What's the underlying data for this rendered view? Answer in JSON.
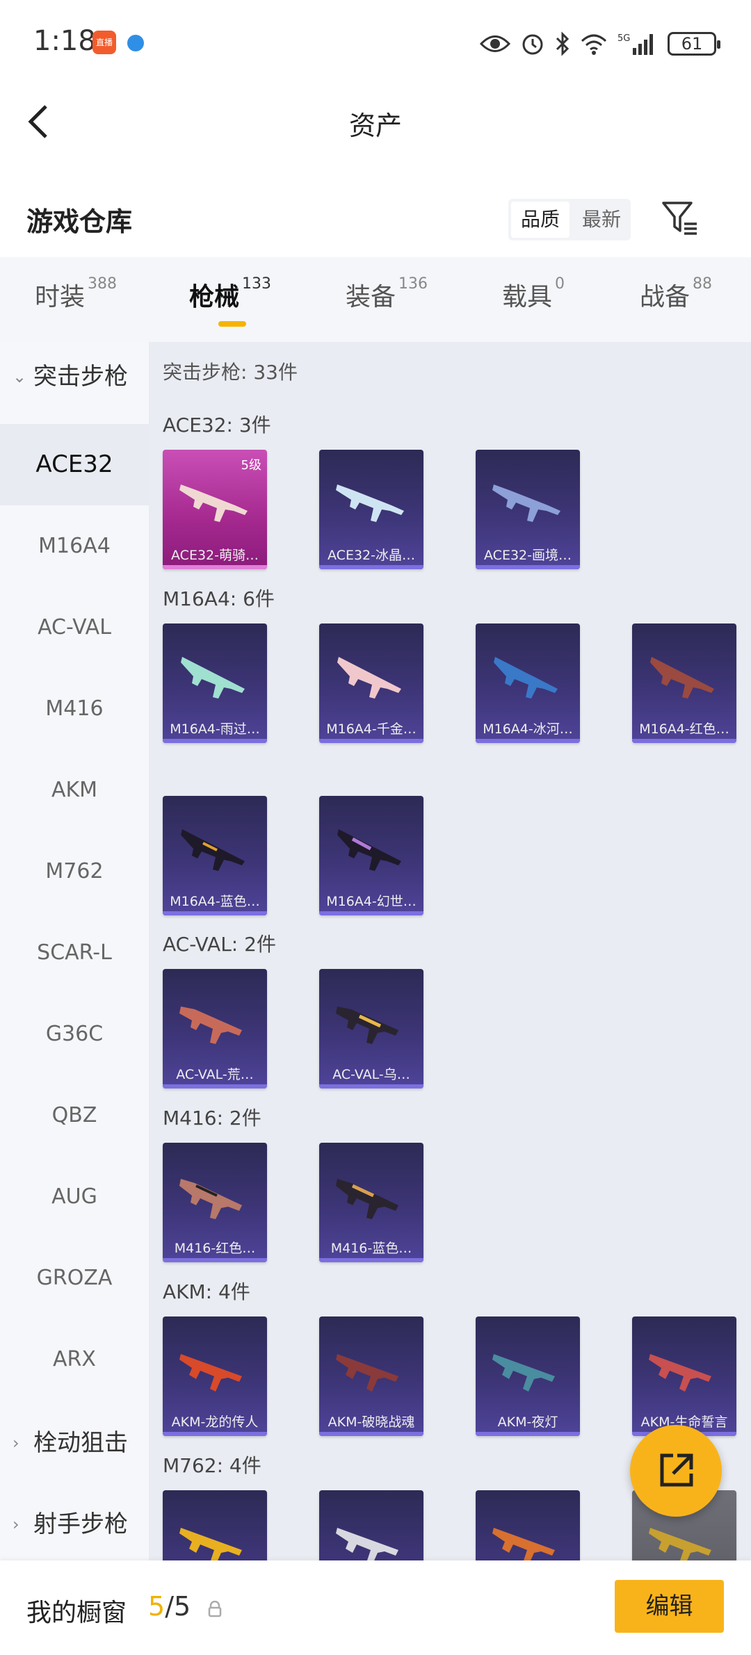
{
  "status_bar": {
    "time": "1:18",
    "app_badge": "直播",
    "battery": "61"
  },
  "header": {
    "title": "资产"
  },
  "section": {
    "title": "游戏仓库",
    "sort_options": [
      "品质",
      "最新"
    ]
  },
  "tabs": [
    {
      "label": "时装",
      "count": "388"
    },
    {
      "label": "枪械",
      "count": "133"
    },
    {
      "label": "装备",
      "count": "136"
    },
    {
      "label": "载具",
      "count": "0"
    },
    {
      "label": "战备",
      "count": "88"
    }
  ],
  "sidebar": {
    "group_assault": "突击步枪",
    "items": [
      "ACE32",
      "M16A4",
      "AC-VAL",
      "M416",
      "AKM",
      "M762",
      "SCAR-L",
      "G36C",
      "QBZ",
      "AUG",
      "GROZA",
      "ARX"
    ],
    "group_bolt": "栓动狙击",
    "group_marksman": "射手步枪"
  },
  "content": {
    "total": "突击步枪: 33件",
    "groups": [
      {
        "title": "ACE32: 3件",
        "cards": [
          "ACE32-萌骑…",
          "ACE32-冰晶…",
          "ACE32-画境…"
        ],
        "level": "5级"
      },
      {
        "title": "M16A4: 6件",
        "cards": [
          "M16A4-雨过…",
          "M16A4-千金…",
          "M16A4-冰河…",
          "M16A4-红色…",
          "M16A4-蓝色…",
          "M16A4-幻世…"
        ]
      },
      {
        "title": "AC-VAL: 2件",
        "cards": [
          "AC-VAL-荒…",
          "AC-VAL-乌…"
        ]
      },
      {
        "title": "M416: 2件",
        "cards": [
          "M416-红色…",
          "M416-蓝色…"
        ]
      },
      {
        "title": "AKM: 4件",
        "cards": [
          "AKM-龙的传人",
          "AKM-破晓战魂",
          "AKM-夜灯",
          "AKM-生命誓言"
        ]
      },
      {
        "title": "M762: 4件",
        "cards": [
          "",
          "",
          "",
          ""
        ]
      }
    ]
  },
  "bottom_bar": {
    "label": "我的橱窗",
    "count_current": "5",
    "count_total": "/5",
    "edit_label": "编辑"
  },
  "colors": {
    "accent": "#f9b31a",
    "card_purple": "#3d3577",
    "card_pink": "#a4288e"
  }
}
